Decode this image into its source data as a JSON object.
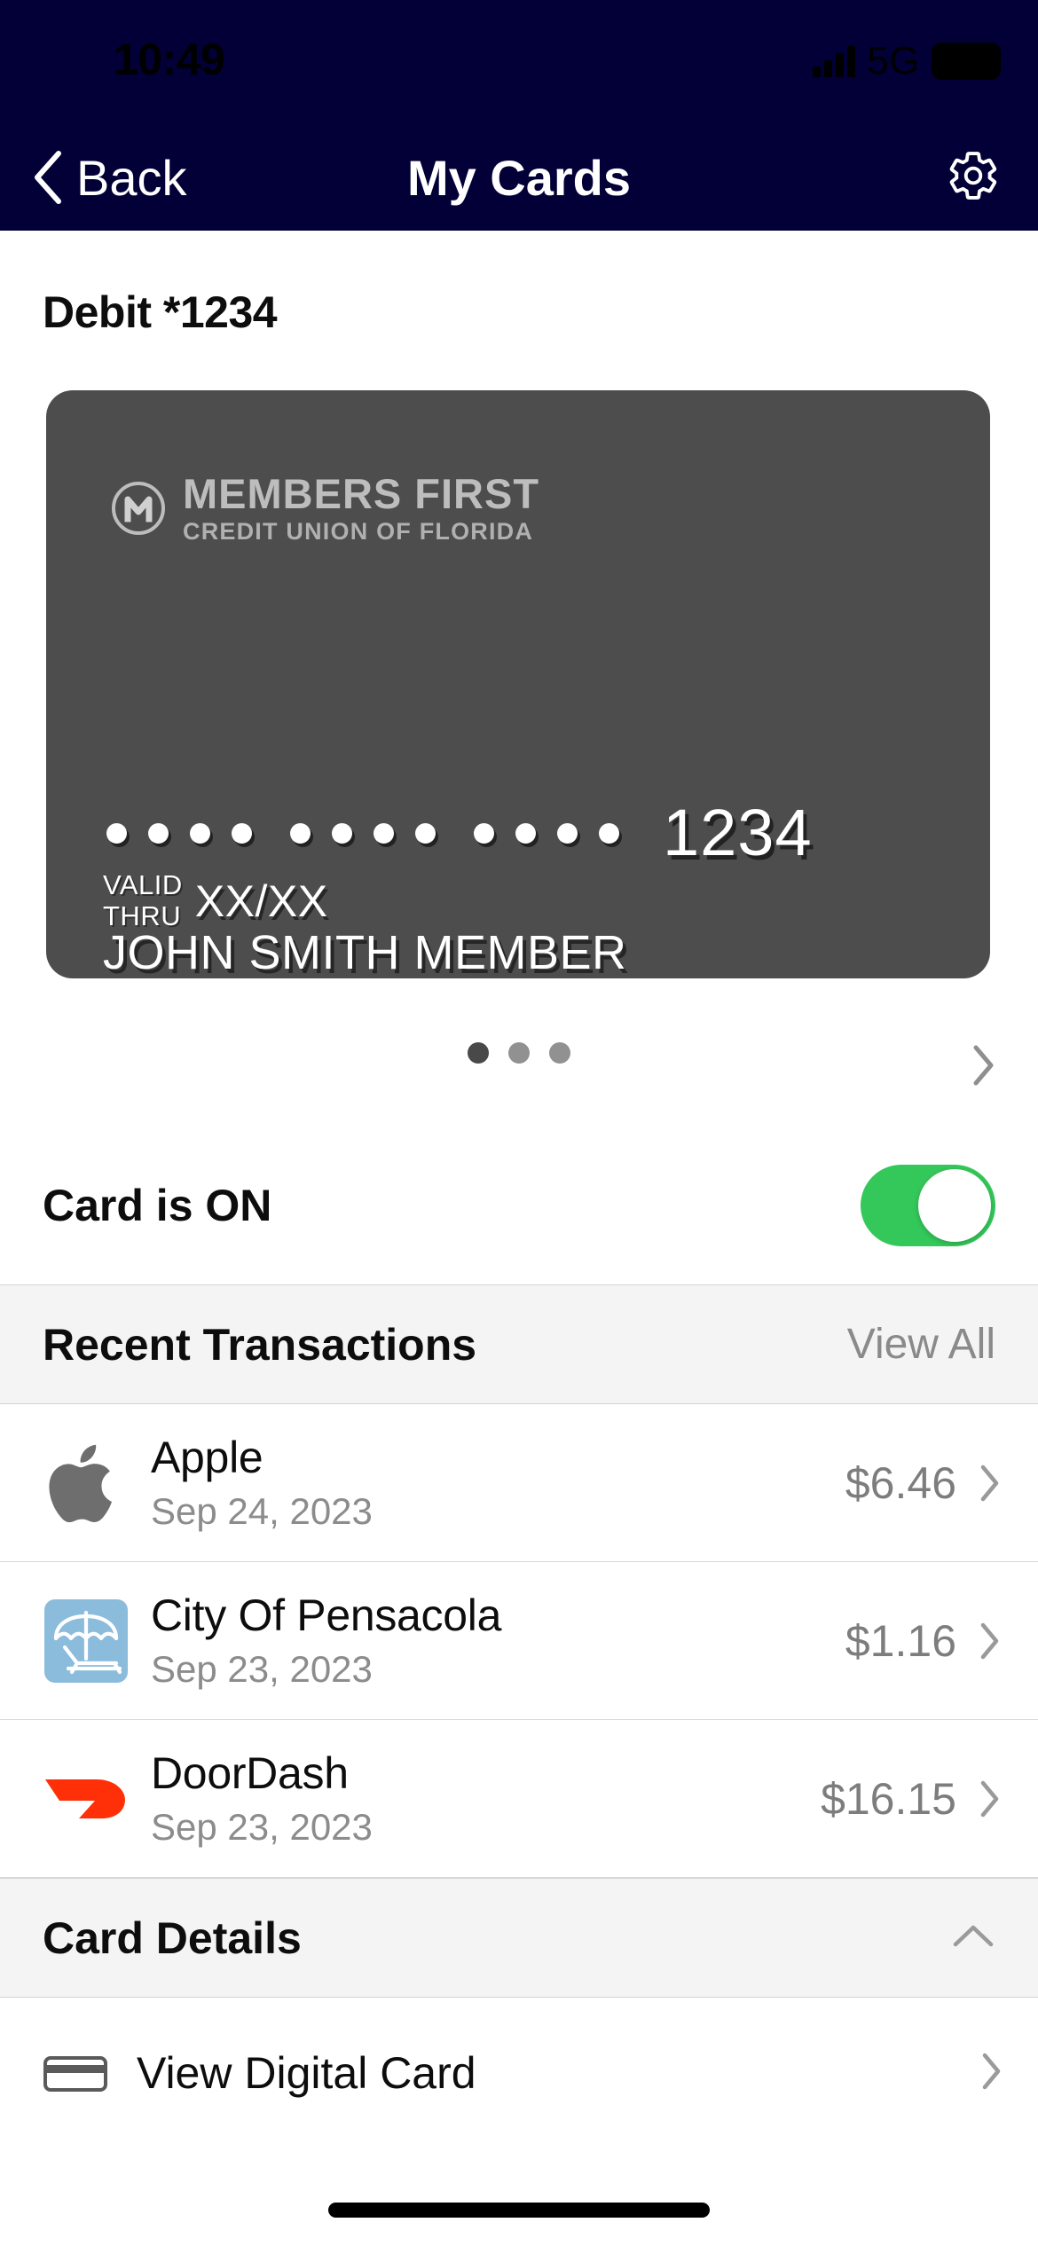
{
  "status_bar": {
    "time": "10:49",
    "network": "5G",
    "battery": "97",
    "signal_icon": "signal-bars-icon",
    "battery_icon": "battery-icon"
  },
  "nav": {
    "back_label": "Back",
    "back_icon": "chevron-left-icon",
    "title": "My Cards",
    "settings_icon": "gear-icon"
  },
  "card_section": {
    "label": "Debit *1234",
    "card": {
      "brand_name": "MEMBERS FIRST",
      "brand_sub": "CREDIT UNION OF FLORIDA",
      "brand_mark_icon": "members-first-m-logo",
      "masked_number": "•••• •••• ••••",
      "last_four": "1234",
      "valid_thru_label_line1": "VALID",
      "valid_thru_label_line2": "THRU",
      "valid_thru_value": "XX/XX",
      "cardholder_name": "JOHN SMITH MEMBER",
      "background_color": "#4d4d4d"
    },
    "pager": {
      "total": 3,
      "active_index": 0,
      "next_icon": "chevron-right-icon"
    }
  },
  "card_toggle": {
    "label": "Card is ON",
    "state": "on",
    "accent_color": "#34C759"
  },
  "transactions_section": {
    "title": "Recent Transactions",
    "action_label": "View All",
    "items": [
      {
        "merchant": "Apple",
        "date": "Sep 24, 2023",
        "amount": "$6.46",
        "icon": "apple-logo-icon",
        "chevron_icon": "chevron-right-icon"
      },
      {
        "merchant": "City Of Pensacola",
        "date": "Sep 23, 2023",
        "amount": "$1.16",
        "icon": "beach-umbrella-icon",
        "icon_background": "#8cbcdc",
        "chevron_icon": "chevron-right-icon"
      },
      {
        "merchant": "DoorDash",
        "date": "Sep 23, 2023",
        "amount": "$16.15",
        "icon": "doordash-logo-icon",
        "icon_color": "#ff3008",
        "chevron_icon": "chevron-right-icon"
      }
    ]
  },
  "card_details_section": {
    "title": "Card Details",
    "collapse_icon": "chevron-up-icon",
    "items": [
      {
        "label": "View Digital Card",
        "icon": "credit-card-icon",
        "chevron_icon": "chevron-right-icon"
      }
    ]
  },
  "home_indicator": "home-indicator"
}
